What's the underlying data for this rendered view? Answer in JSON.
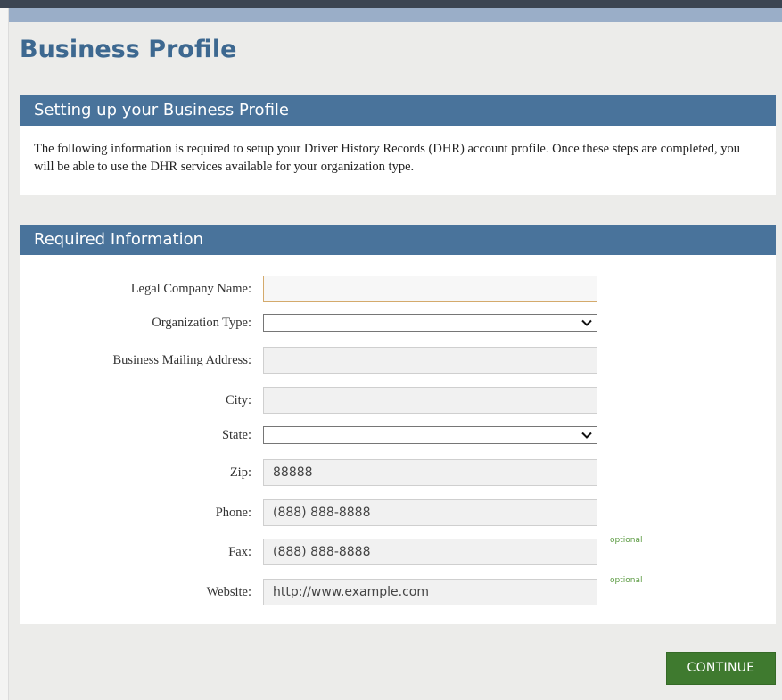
{
  "page": {
    "title": "Business Profile"
  },
  "intro": {
    "header": "Setting up your Business Profile",
    "text": "The following information is required to setup your Driver History Records (DHR) account profile. Once these steps are completed, you will be able to use the DHR services available for your organization type."
  },
  "required": {
    "header": "Required Information",
    "fields": {
      "legal_company_name": {
        "label": "Legal Company Name:",
        "value": ""
      },
      "organization_type": {
        "label": "Organization Type:",
        "value": ""
      },
      "business_mailing_address": {
        "label": "Business Mailing Address:",
        "value": ""
      },
      "city": {
        "label": "City:",
        "value": ""
      },
      "state": {
        "label": "State:",
        "value": ""
      },
      "zip": {
        "label": "Zip:",
        "placeholder": "88888"
      },
      "phone": {
        "label": "Phone:",
        "placeholder": "(888) 888-8888"
      },
      "fax": {
        "label": "Fax:",
        "placeholder": "(888) 888-8888",
        "note": "optional"
      },
      "website": {
        "label": "Website:",
        "placeholder": "http://www.example.com",
        "note": "optional"
      }
    }
  },
  "actions": {
    "continue_label": "CONTINUE"
  },
  "colors": {
    "title": "#3d6890",
    "panel_header": "#49739b",
    "continue_button": "#3f7a2f",
    "optional_text": "#5a9a40",
    "active_field_border": "#d4aa6c"
  }
}
